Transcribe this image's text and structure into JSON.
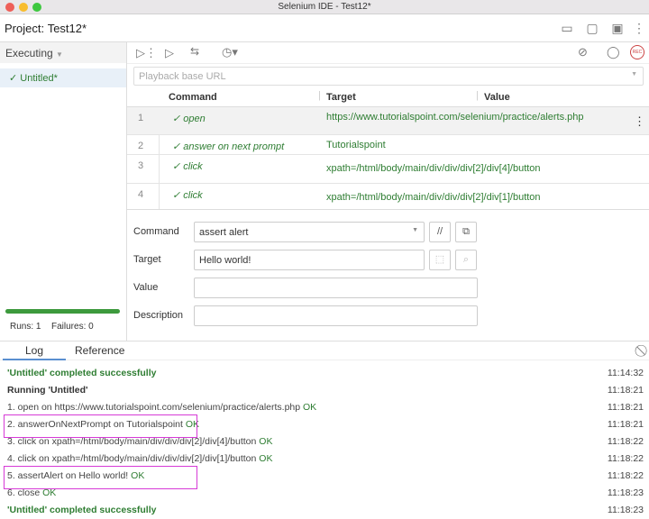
{
  "window": {
    "title": "Selenium IDE - Test12*",
    "traffic": [
      "#ee5f58",
      "#f8bd2e",
      "#3ec840"
    ]
  },
  "header": {
    "project_label": "Project:",
    "project_name": "Test12*",
    "icons": [
      "new-project-icon",
      "open-folder-icon",
      "save-icon",
      "more-vert-icon"
    ]
  },
  "sidebar": {
    "dropdown": "Executing",
    "tests": [
      {
        "label": "✓ Untitled*"
      }
    ],
    "progress": 1.0,
    "runs": "Runs: 1",
    "failures": "Failures: 0"
  },
  "toolbar": {
    "icons": [
      "run-all-icon",
      "run-icon",
      "step-icon",
      "speed-icon",
      "disable-breakpoints-icon",
      "pause-icon",
      "record-icon"
    ],
    "rec_label": "REC"
  },
  "url": {
    "placeholder": "Playback base URL"
  },
  "table": {
    "headers": [
      "Command",
      "Target",
      "Value"
    ],
    "rows": [
      {
        "n": "1",
        "command": "✓ open",
        "target": "https://www.tutorialspoint.com/selenium/practice/alerts.php",
        "value": ""
      },
      {
        "n": "2",
        "command": "✓ answer on next prompt",
        "target": "Tutorialspoint",
        "value": ""
      },
      {
        "n": "3",
        "command": "✓ click",
        "target": "xpath=/html/body/main/div/div/div[2]/div[4]/button",
        "value": ""
      },
      {
        "n": "4",
        "command": "✓ click",
        "target": "xpath=/html/body/main/div/div/div[2]/div[1]/button",
        "value": ""
      }
    ]
  },
  "editor": {
    "command_label": "Command",
    "command_value": "assert alert",
    "target_label": "Target",
    "target_value": "Hello world!",
    "value_label": "Value",
    "value_value": "",
    "description_label": "Description",
    "description_value": "",
    "comment_btn": "//"
  },
  "log": {
    "tabs": [
      "Log",
      "Reference"
    ],
    "active_tab": "Log",
    "lines": [
      {
        "text": "'Untitled' completed successfully",
        "ok": "",
        "time": "11:14:32",
        "style": "success"
      },
      {
        "text": "Running 'Untitled'",
        "ok": "",
        "time": "11:18:21",
        "style": "bold"
      },
      {
        "text": "1.   open on https://www.tutorialspoint.com/selenium/practice/alerts.php ",
        "ok": "OK",
        "time": "11:18:21",
        "style": "normal"
      },
      {
        "text": "2.   answerOnNextPrompt on Tutorialspoint ",
        "ok": "OK",
        "time": "11:18:21",
        "style": "normal"
      },
      {
        "text": "3.   click on xpath=/html/body/main/div/div/div[2]/div[4]/button ",
        "ok": "OK",
        "time": "11:18:22",
        "style": "normal"
      },
      {
        "text": "4.   click on xpath=/html/body/main/div/div/div[2]/div[1]/button ",
        "ok": "OK",
        "time": "11:18:22",
        "style": "normal"
      },
      {
        "text": "5.   assertAlert on Hello world! ",
        "ok": "OK",
        "time": "11:18:22",
        "style": "normal"
      },
      {
        "text": "6.   close ",
        "ok": "OK",
        "time": "11:18:23",
        "style": "normal"
      },
      {
        "text": "'Untitled' completed successfully",
        "ok": "",
        "time": "11:18:23",
        "style": "success"
      }
    ]
  }
}
